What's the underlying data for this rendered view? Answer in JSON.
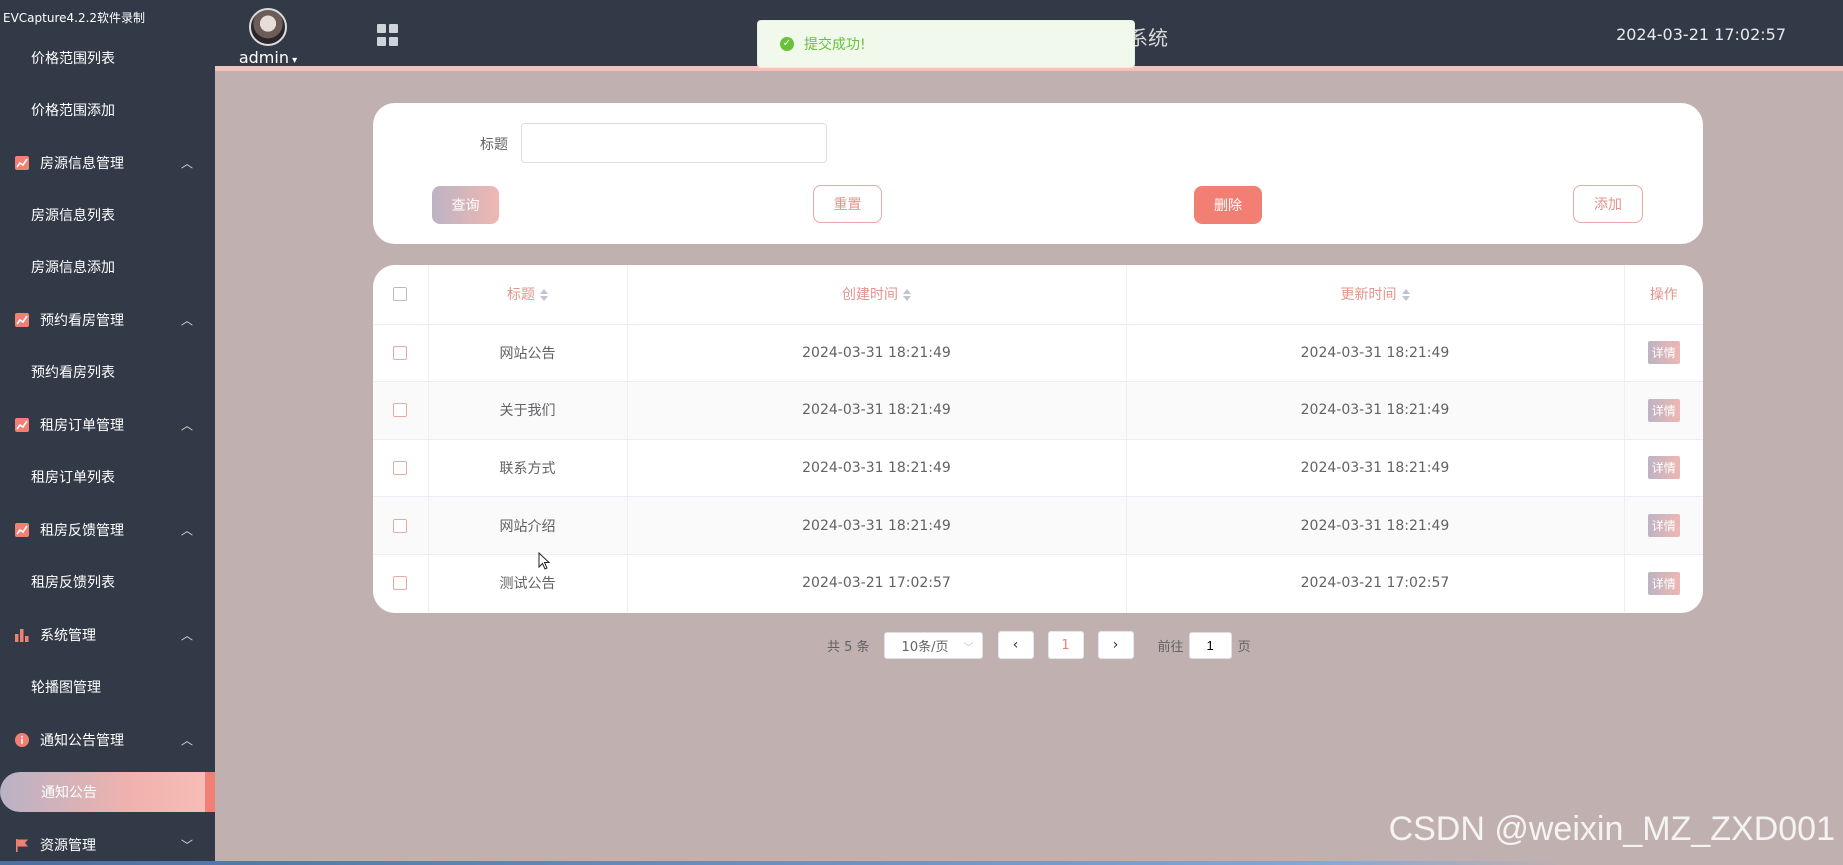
{
  "recorder_label": "EVCapture4.2.2软件录制",
  "header": {
    "username": "admin",
    "title_fragment": "系统",
    "datetime": "2024-03-21 17:02:57"
  },
  "toast": {
    "message": "提交成功!"
  },
  "sidebar": {
    "items": [
      {
        "type": "sub",
        "label": "价格范围列表"
      },
      {
        "type": "sub",
        "label": "价格范围添加"
      },
      {
        "type": "group",
        "label": "房源信息管理",
        "icon": "chart-icon"
      },
      {
        "type": "sub",
        "label": "房源信息列表"
      },
      {
        "type": "sub",
        "label": "房源信息添加"
      },
      {
        "type": "group",
        "label": "预约看房管理",
        "icon": "chart-icon"
      },
      {
        "type": "sub",
        "label": "预约看房列表"
      },
      {
        "type": "group",
        "label": "租房订单管理",
        "icon": "chart-icon"
      },
      {
        "type": "sub",
        "label": "租房订单列表"
      },
      {
        "type": "group",
        "label": "租房反馈管理",
        "icon": "chart-icon"
      },
      {
        "type": "sub",
        "label": "租房反馈列表"
      },
      {
        "type": "group",
        "label": "系统管理",
        "icon": "bar-icon"
      },
      {
        "type": "sub",
        "label": "轮播图管理"
      },
      {
        "type": "group",
        "label": "通知公告管理",
        "icon": "info-icon"
      },
      {
        "type": "active",
        "label": "通知公告"
      },
      {
        "type": "group",
        "label": "资源管理",
        "icon": "flag-icon"
      }
    ]
  },
  "search": {
    "label": "标题",
    "value": "",
    "query_label": "查询",
    "reset_label": "重置",
    "delete_label": "删除",
    "add_label": "添加"
  },
  "table": {
    "columns": [
      "标题",
      "创建时间",
      "更新时间",
      "操作"
    ],
    "detail_label": "详情",
    "rows": [
      {
        "title": "网站公告",
        "created": "2024-03-31 18:21:49",
        "updated": "2024-03-31 18:21:49"
      },
      {
        "title": "关于我们",
        "created": "2024-03-31 18:21:49",
        "updated": "2024-03-31 18:21:49"
      },
      {
        "title": "联系方式",
        "created": "2024-03-31 18:21:49",
        "updated": "2024-03-31 18:21:49"
      },
      {
        "title": "网站介绍",
        "created": "2024-03-31 18:21:49",
        "updated": "2024-03-31 18:21:49"
      },
      {
        "title": "测试公告",
        "created": "2024-03-21 17:02:57",
        "updated": "2024-03-21 17:02:57"
      }
    ]
  },
  "pagination": {
    "total": "共 5 条",
    "page_size": "10条/页",
    "current_page": "1",
    "goto_prefix": "前往",
    "goto_value": "1",
    "goto_suffix": "页"
  },
  "watermark": "CSDN @weixin_MZ_ZXD001",
  "colors": {
    "sidebar_bg": "#333a47",
    "accent": "#f27f74",
    "content_bg": "#c0b1b0",
    "success": "#67c23a"
  }
}
